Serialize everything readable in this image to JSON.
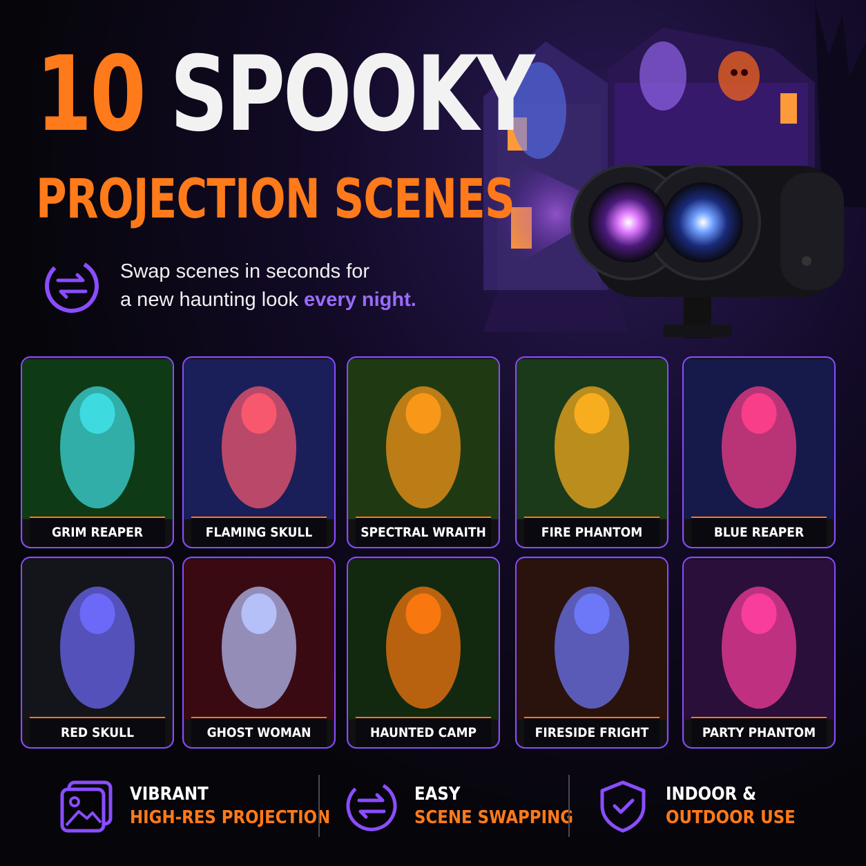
{
  "headline": {
    "number": "10",
    "word": "SPOOKY",
    "line2": "PROJECTION SCENES"
  },
  "swap": {
    "line1": "Swap scenes in seconds for",
    "line2_prefix": "a new haunting look ",
    "line2_accent": "every night."
  },
  "scenes": [
    {
      "label": "GRIM REAPER",
      "icon": "grim-reaper-image",
      "color": "#3fe0e6",
      "bg": "#0f3a16"
    },
    {
      "label": "FLAMING SKULL",
      "icon": "flaming-skull-image",
      "color": "#ff5a6e",
      "bg": "#1a1f5a"
    },
    {
      "label": "SPECTRAL WRAITH",
      "icon": "spectral-wraith-image",
      "color": "#ff9a1a",
      "bg": "#1f3a12"
    },
    {
      "label": "FIRE PHANTOM",
      "icon": "fire-phantom-image",
      "color": "#ffb020",
      "bg": "#1a3a1a"
    },
    {
      "label": "BLUE REAPER",
      "icon": "blue-reaper-image",
      "color": "#ff3f8a",
      "bg": "#151a4a"
    },
    {
      "label": "RED SKULL",
      "icon": "red-skull-image",
      "color": "#6f6bff",
      "bg": "#14151a"
    },
    {
      "label": "GHOST WOMAN",
      "icon": "ghost-woman-image",
      "color": "#b9c4ff",
      "bg": "#3a0a12"
    },
    {
      "label": "HAUNTED CAMP",
      "icon": "haunted-camp-image",
      "color": "#ff7a10",
      "bg": "#12280f"
    },
    {
      "label": "FIRESIDE FRIGHT",
      "icon": "fireside-fright-image",
      "color": "#6f7bff",
      "bg": "#2a130c"
    },
    {
      "label": "PARTY PHANTOM",
      "icon": "party-phantom-image",
      "color": "#ff3fa0",
      "bg": "#2a0f3a"
    }
  ],
  "features": [
    {
      "line1": "VIBRANT",
      "line2": "HIGH-RES PROJECTION",
      "icon": "image-gallery-icon"
    },
    {
      "line1": "EASY",
      "line2": "SCENE SWAPPING",
      "icon": "swap-arrows-icon"
    },
    {
      "line1": "INDOOR &",
      "line2": "OUTDOOR USE",
      "icon": "shield-check-icon"
    }
  ],
  "colors": {
    "accent_orange": "#ff7a1a",
    "accent_purple": "#8a4dff"
  }
}
